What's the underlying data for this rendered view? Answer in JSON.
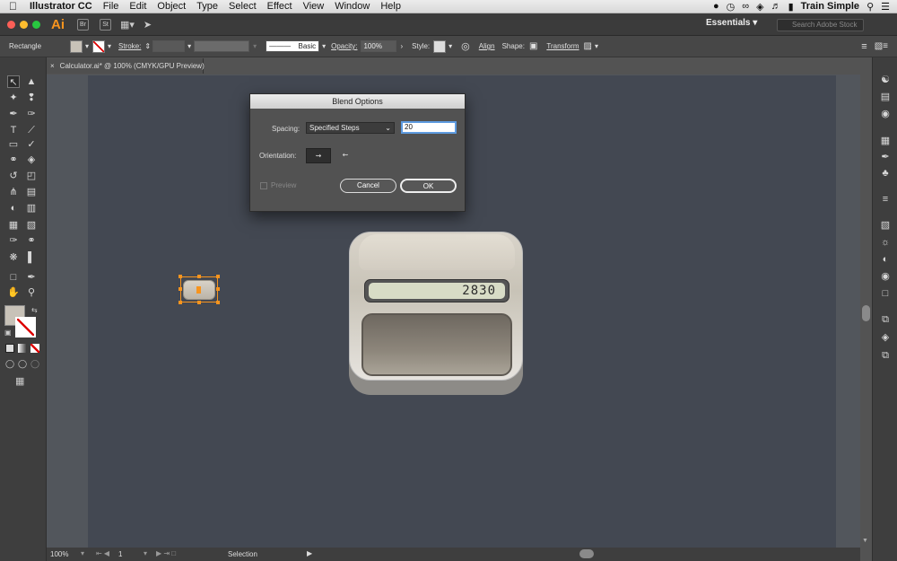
{
  "menubar": {
    "apple": "",
    "app": "Illustrator CC",
    "items": [
      "File",
      "Edit",
      "Object",
      "Type",
      "Select",
      "Effect",
      "View",
      "Window",
      "Help"
    ],
    "user": "Train Simple"
  },
  "appbar": {
    "ai": "Ai",
    "br": "Br",
    "st": "St",
    "workspace": "Essentials",
    "search_placeholder": "Search Adobe Stock"
  },
  "control": {
    "selection_type": "Rectangle",
    "stroke_label": "Stroke:",
    "brush": "Basic",
    "opacity_label": "Opacity:",
    "opacity": "100%",
    "style_label": "Style:",
    "align": "Align",
    "shape_label": "Shape:",
    "transform": "Transform",
    "fill_color": "#c8c2b8"
  },
  "doc": {
    "tab": "Calculator.ai* @ 100% (CMYK/GPU Preview)",
    "close": "×"
  },
  "dialog": {
    "title": "Blend Options",
    "spacing_label": "Spacing:",
    "spacing_value": "Specified Steps",
    "steps": "20",
    "orientation_label": "Orientation:",
    "preview_label": "Preview",
    "cancel": "Cancel",
    "ok": "OK"
  },
  "calculator": {
    "display": "2830"
  },
  "status": {
    "zoom": "100%",
    "page": "1",
    "mode": "Selection"
  }
}
